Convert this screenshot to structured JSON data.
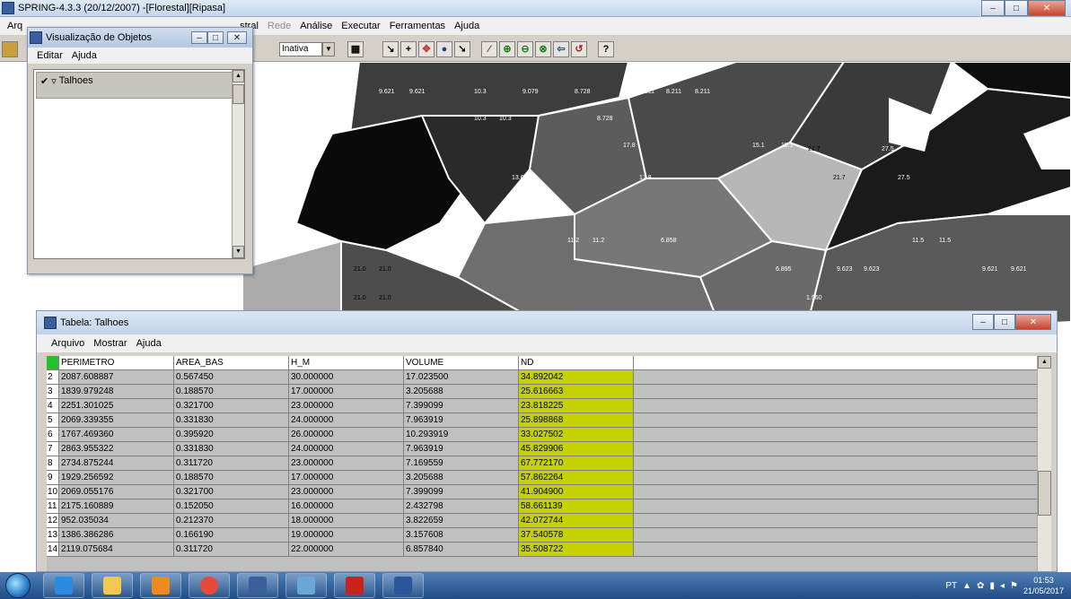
{
  "app": {
    "title": "SPRING-4.3.3 (20/12/2007) -[Florestal][Ripasa]",
    "menu": [
      "Arq",
      "stral",
      "Rede",
      "Análise",
      "Executar",
      "Ferramentas",
      "Ajuda"
    ],
    "toolbar": {
      "select_value": "Inativa",
      "help_label": "?"
    }
  },
  "objects_window": {
    "title": "Visualização de Objetos",
    "menu": [
      "Editar",
      "Ajuda"
    ],
    "items": [
      {
        "label": "Talhoes",
        "checked": true,
        "check_glyph": "✔",
        "expander": "▿"
      }
    ]
  },
  "table_window": {
    "title": "Tabela: Talhoes",
    "menu": [
      "Arquivo",
      "Mostrar",
      "Ajuda"
    ],
    "columns": [
      "PERIMETRO",
      "AREA_BAS",
      "H_M",
      "VOLUME",
      "ND"
    ],
    "rows": [
      {
        "idx": "2",
        "perimetro": "2087.608887",
        "area_bas": "0.567450",
        "h_m": "30.000000",
        "volume": "17.023500",
        "nd": "34.892042"
      },
      {
        "idx": "3",
        "perimetro": "1839.979248",
        "area_bas": "0.188570",
        "h_m": "17.000000",
        "volume": "3.205688",
        "nd": "25.616663"
      },
      {
        "idx": "4",
        "perimetro": "2251.301025",
        "area_bas": "0.321700",
        "h_m": "23.000000",
        "volume": "7.399099",
        "nd": "23.818225"
      },
      {
        "idx": "5",
        "perimetro": "2069.339355",
        "area_bas": "0.331830",
        "h_m": "24.000000",
        "volume": "7.963919",
        "nd": "25.898868"
      },
      {
        "idx": "6",
        "perimetro": "1767.469360",
        "area_bas": "0.395920",
        "h_m": "26.000000",
        "volume": "10.293919",
        "nd": "33.027502"
      },
      {
        "idx": "7",
        "perimetro": "2863.955322",
        "area_bas": "0.331830",
        "h_m": "24.000000",
        "volume": "7.963919",
        "nd": "45.829906"
      },
      {
        "idx": "8",
        "perimetro": "2734.875244",
        "area_bas": "0.311720",
        "h_m": "23.000000",
        "volume": "7.169559",
        "nd": "67.772170"
      },
      {
        "idx": "9",
        "perimetro": "1929.256592",
        "area_bas": "0.188570",
        "h_m": "17.000000",
        "volume": "3.205688",
        "nd": "57.862264"
      },
      {
        "idx": "10",
        "perimetro": "2069.055176",
        "area_bas": "0.321700",
        "h_m": "23.000000",
        "volume": "7.399099",
        "nd": "41.904900"
      },
      {
        "idx": "11",
        "perimetro": "2175.160889",
        "area_bas": "0.152050",
        "h_m": "16.000000",
        "volume": "2.432798",
        "nd": "58.661139"
      },
      {
        "idx": "12",
        "perimetro": "952.035034",
        "area_bas": "0.212370",
        "h_m": "18.000000",
        "volume": "3.822659",
        "nd": "42.072744"
      },
      {
        "idx": "13",
        "perimetro": "1386.386286",
        "area_bas": "0.166190",
        "h_m": "19.000000",
        "volume": "3.157608",
        "nd": "37.540578"
      },
      {
        "idx": "14",
        "perimetro": "2119.075684",
        "area_bas": "0.311720",
        "h_m": "22.000000",
        "volume": "6.857840",
        "nd": "35.508722"
      }
    ],
    "nd_color": "#c6d100"
  },
  "map_labels": [
    {
      "text": "9.621"
    },
    {
      "text": "9.621"
    },
    {
      "text": "10.3"
    },
    {
      "text": "9.079"
    },
    {
      "text": "8.728"
    },
    {
      "text": "8.211"
    },
    {
      "text": "8.211"
    },
    {
      "text": "8.211"
    },
    {
      "text": "10.3"
    },
    {
      "text": "10.3"
    },
    {
      "text": "8.728"
    },
    {
      "text": "17.8"
    },
    {
      "text": "13.6"
    },
    {
      "text": "13.6"
    },
    {
      "text": "17.8"
    },
    {
      "text": "15.1"
    },
    {
      "text": "15.1"
    },
    {
      "text": "21.7"
    },
    {
      "text": "21.7"
    },
    {
      "text": "27.5"
    },
    {
      "text": "27.5"
    },
    {
      "text": "11.5"
    },
    {
      "text": "11.5"
    },
    {
      "text": "11.2"
    },
    {
      "text": "11.2"
    },
    {
      "text": "6.858"
    },
    {
      "text": "6.895"
    },
    {
      "text": "9.623"
    },
    {
      "text": "9.623"
    },
    {
      "text": "9.621"
    },
    {
      "text": "9.621"
    },
    {
      "text": "21.0"
    },
    {
      "text": "21.0"
    },
    {
      "text": "21.0"
    },
    {
      "text": "21.0"
    },
    {
      "text": "1.960"
    }
  ],
  "taskbar": {
    "language": "PT",
    "time": "01:53",
    "date": "21/05/2017"
  }
}
